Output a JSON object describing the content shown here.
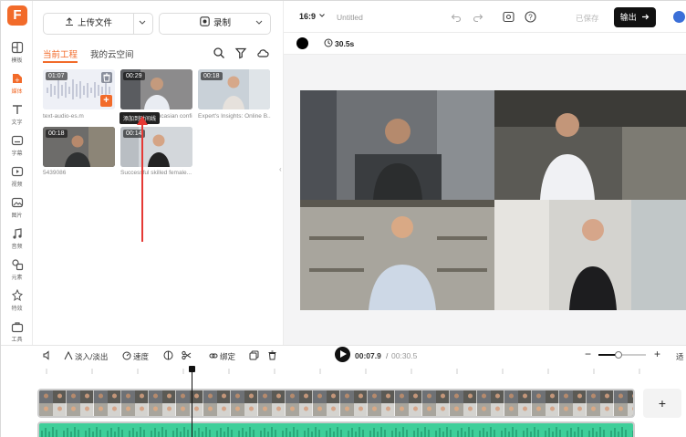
{
  "rail": {
    "items": [
      {
        "label": "模板",
        "icon": "template-icon"
      },
      {
        "label": "媒体",
        "icon": "media-icon"
      },
      {
        "label": "文字",
        "icon": "text-icon"
      },
      {
        "label": "字幕",
        "icon": "subtitle-icon"
      },
      {
        "label": "视频",
        "icon": "video-icon"
      },
      {
        "label": "图片",
        "icon": "image-icon"
      },
      {
        "label": "音频",
        "icon": "audio-icon"
      },
      {
        "label": "元素",
        "icon": "elements-icon"
      },
      {
        "label": "特效",
        "icon": "effects-icon"
      },
      {
        "label": "工具",
        "icon": "tools-icon"
      }
    ],
    "active_index": 1
  },
  "panel": {
    "upload_label": "上传文件",
    "record_label": "录制",
    "tabs": [
      "当前工程",
      "我的云空间"
    ],
    "active_tab": 0,
    "media": [
      {
        "duration": "01:07",
        "caption": "text-audio-es.m",
        "type": "audio"
      },
      {
        "duration": "00:29",
        "caption": "...itive caucasian confid..."
      },
      {
        "duration": "00:18",
        "caption": "Expert's Insights: Online B..."
      },
      {
        "duration": "00:18",
        "caption": "5439086"
      },
      {
        "duration": "00:14",
        "caption": "Successful skilled female..."
      }
    ],
    "tooltip": "添加到时间线",
    "add_symbol": "+"
  },
  "preview": {
    "aspect_ratio": "16:9",
    "project_title": "Untitled",
    "saved_label": "已保存",
    "export_label": "输出",
    "duration_label": "30.5s",
    "bg_color": "#000000"
  },
  "timeline": {
    "fade_label": "淡入/淡出",
    "speed_label": "速度",
    "bind_label": "绑定",
    "current_time": "00:07.9",
    "total_time": "00:30.5",
    "overflow_label": "适",
    "add_symbol": "+",
    "zoom_minus": "−",
    "zoom_plus": "+",
    "zoom_level": 0.3
  },
  "colors": {
    "accent": "#f26b2a",
    "annotation_red": "#e53935",
    "audio_track": "#3fcf9a"
  }
}
